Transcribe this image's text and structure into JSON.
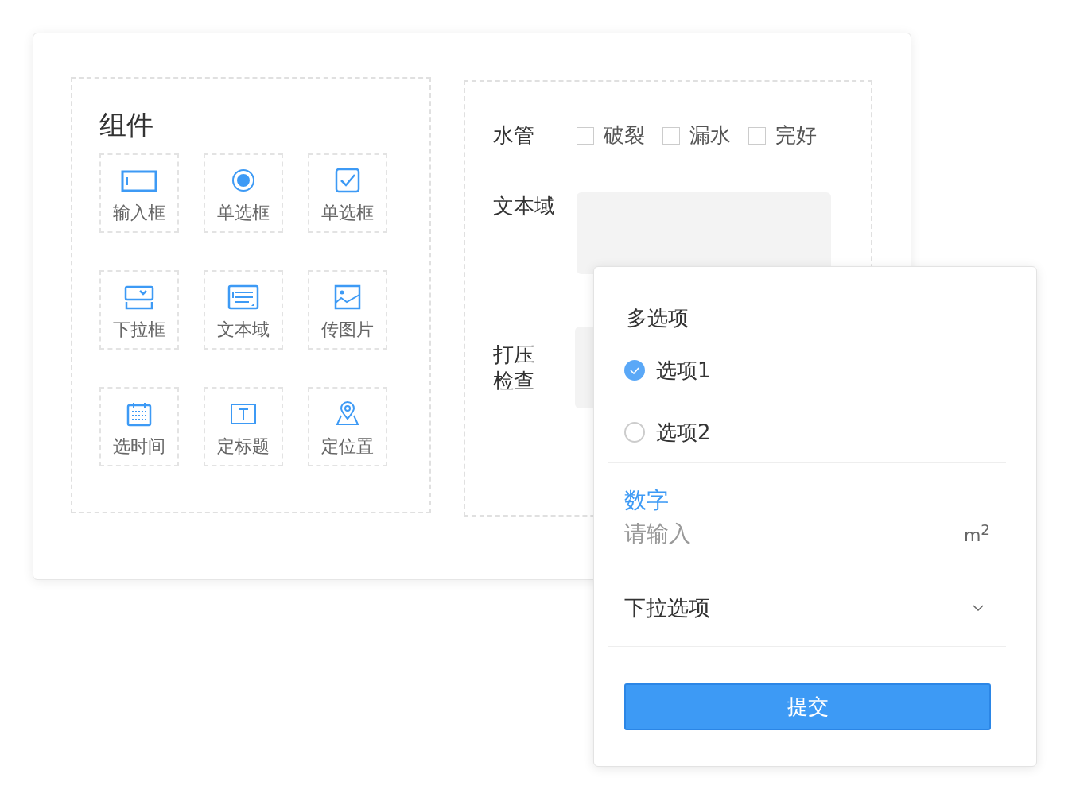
{
  "components": {
    "title": "组件",
    "items": [
      {
        "kind": "input",
        "label": "输入框"
      },
      {
        "kind": "radio",
        "label": "单选框"
      },
      {
        "kind": "checkbox",
        "label": "单选框"
      },
      {
        "kind": "select",
        "label": "下拉框"
      },
      {
        "kind": "textarea",
        "label": "文本域"
      },
      {
        "kind": "image",
        "label": "传图片"
      },
      {
        "kind": "date",
        "label": "选时间"
      },
      {
        "kind": "title",
        "label": "定标题"
      },
      {
        "kind": "location",
        "label": "定位置"
      }
    ]
  },
  "form": {
    "pipe": {
      "label": "水管",
      "options": [
        {
          "label": "破裂",
          "checked": false
        },
        {
          "label": "漏水",
          "checked": false
        },
        {
          "label": "完好",
          "checked": false
        }
      ]
    },
    "textarea": {
      "label": "文本域"
    },
    "pressure": {
      "label": "打压检查"
    }
  },
  "popup": {
    "multi": {
      "title": "多选项",
      "options": [
        {
          "label": "选项1",
          "selected": true
        },
        {
          "label": "选项2",
          "selected": false
        }
      ]
    },
    "number": {
      "label": "数字",
      "placeholder": "请输入",
      "unit": "m$^{2}$"
    },
    "dropdown": {
      "label": "下拉选项"
    },
    "submit": "提交"
  }
}
